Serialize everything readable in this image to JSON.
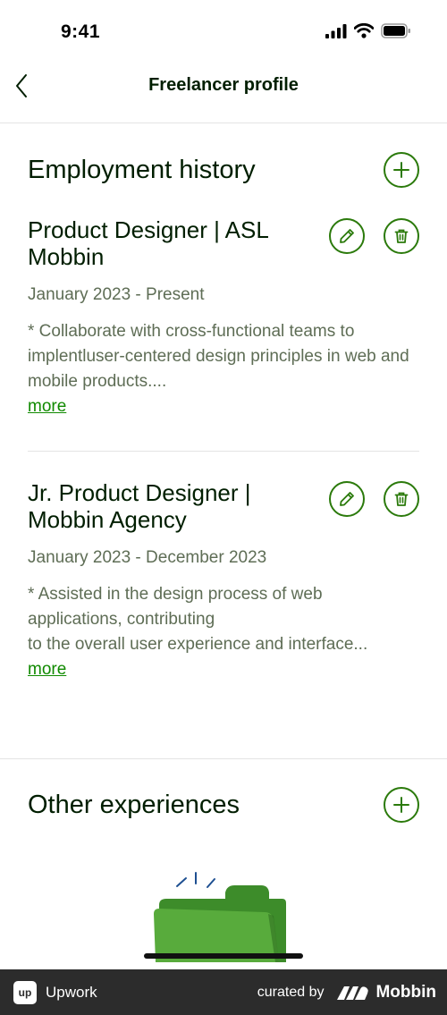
{
  "status_bar": {
    "time": "9:41"
  },
  "nav": {
    "title": "Freelancer profile"
  },
  "employment": {
    "title": "Employment history",
    "jobs": [
      {
        "title": "Product Designer | ASL Mobbin",
        "dates": "January 2023 - Present",
        "description": "* Collaborate with cross-functional teams to implentluser-centered design principles in web and mobile products....",
        "more": "more"
      },
      {
        "title": "Jr. Product Designer | Mobbin Agency",
        "dates": "January 2023 - December 2023",
        "description": "* Assisted in the design process of web applications, contributing\nto the overall user experience and interface...",
        "more": "more"
      }
    ]
  },
  "other": {
    "title": "Other experiences"
  },
  "footer": {
    "brand": "Upwork",
    "logo_text": "up",
    "curated": "curated by",
    "mobbin": "Mobbin"
  },
  "colors": {
    "accent": "#108a00",
    "accent_border": "#2b7a0b",
    "text": "#001e00",
    "muted": "#5e6d55"
  }
}
